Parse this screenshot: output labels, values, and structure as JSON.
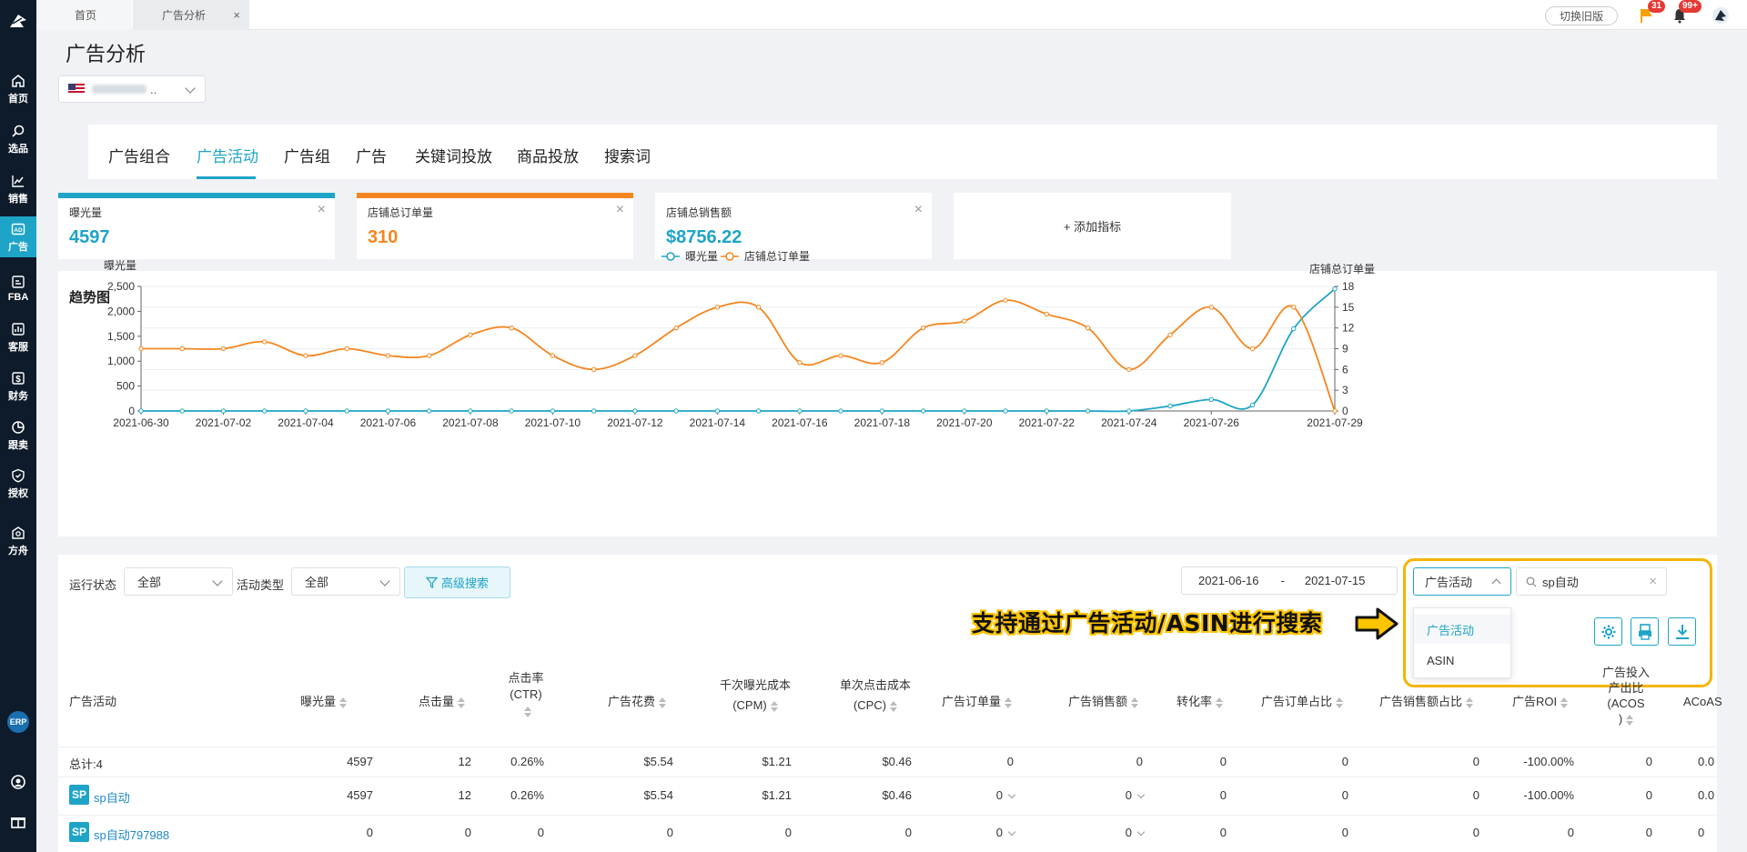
{
  "sidebar": {
    "items": [
      {
        "label": "首页",
        "icon": "home-icon"
      },
      {
        "label": "选品",
        "icon": "search-icon"
      },
      {
        "label": "销售",
        "icon": "chart-line-icon"
      },
      {
        "label": "广告",
        "icon": "ad-icon"
      },
      {
        "label": "FBA",
        "icon": "fba-icon"
      },
      {
        "label": "客服",
        "icon": "bar-chart-icon"
      },
      {
        "label": "财务",
        "icon": "dollar-icon"
      },
      {
        "label": "跟卖",
        "icon": "pie-chart-icon"
      },
      {
        "label": "授权",
        "icon": "shield-icon"
      },
      {
        "label": "方舟",
        "icon": "ark-icon"
      }
    ],
    "erp_label": "ERP"
  },
  "topbar": {
    "tabs": [
      {
        "label": "首页"
      },
      {
        "label": "广告分析"
      }
    ],
    "close_symbol": "×",
    "switch_label": "切换旧版",
    "flag_badge": "31",
    "bell_badge": "99+"
  },
  "page": {
    "title": "广告分析",
    "store_suffix": ".."
  },
  "nav": {
    "tabs": [
      "广告组合",
      "广告活动",
      "广告组",
      "广告",
      "关键词投放",
      "商品投放",
      "搜索词"
    ],
    "active_index": 1
  },
  "kpis": [
    {
      "label": "曝光量",
      "value": "4597",
      "color": "#1ea4c7"
    },
    {
      "label": "店铺总订单量",
      "value": "310",
      "color": "#f5861f"
    },
    {
      "label": "店铺总销售额",
      "value": "$8756.22",
      "color": "#1ea4c7"
    }
  ],
  "kpi_add_label": "+ 添加指标",
  "chart": {
    "title": "趋势图",
    "chart_data": {
      "type": "line",
      "x": [
        "2021-06-30",
        "2021-07-01",
        "2021-07-02",
        "2021-07-03",
        "2021-07-04",
        "2021-07-05",
        "2021-07-06",
        "2021-07-07",
        "2021-07-08",
        "2021-07-09",
        "2021-07-10",
        "2021-07-11",
        "2021-07-12",
        "2021-07-13",
        "2021-07-14",
        "2021-07-15",
        "2021-07-16",
        "2021-07-17",
        "2021-07-18",
        "2021-07-19",
        "2021-07-20",
        "2021-07-21",
        "2021-07-22",
        "2021-07-23",
        "2021-07-24",
        "2021-07-25",
        "2021-07-26",
        "2021-07-27",
        "2021-07-28",
        "2021-07-29"
      ],
      "x_tick_labels": [
        "2021-06-30",
        "2021-07-02",
        "2021-07-04",
        "2021-07-06",
        "2021-07-08",
        "2021-07-10",
        "2021-07-12",
        "2021-07-14",
        "2021-07-16",
        "2021-07-18",
        "2021-07-20",
        "2021-07-22",
        "2021-07-24",
        "2021-07-26",
        "2021-07-29"
      ],
      "series": [
        {
          "name": "曝光量",
          "axis": "left",
          "color": "#1ea4c7",
          "values": [
            0,
            0,
            0,
            0,
            0,
            0,
            0,
            0,
            0,
            0,
            0,
            0,
            0,
            0,
            0,
            0,
            0,
            0,
            0,
            0,
            0,
            0,
            0,
            0,
            0,
            100,
            230,
            120,
            1650,
            2450
          ]
        },
        {
          "name": "店铺总订单量",
          "axis": "right",
          "color": "#f5861f",
          "values": [
            9,
            9,
            9,
            10,
            8,
            9,
            8,
            8,
            11,
            12,
            8,
            6,
            8,
            12,
            15,
            15,
            7,
            8,
            7,
            12,
            13,
            16,
            14,
            12,
            6,
            11,
            15,
            9,
            15,
            0
          ]
        }
      ],
      "ylabel_left": "曝光量",
      "ylabel_right": "店铺总订单量",
      "yticks_left": [
        "0",
        "500",
        "1,000",
        "1,500",
        "2,000",
        "2,500"
      ],
      "yticks_right": [
        "0",
        "3",
        "6",
        "9",
        "12",
        "15",
        "18"
      ],
      "ylim_left": [
        0,
        2500
      ],
      "ylim_right": [
        0,
        18
      ],
      "legend_position": "top-center",
      "grid": true
    }
  },
  "filters": {
    "status_label": "运行状态",
    "status_value": "全部",
    "type_label": "活动类型",
    "type_value": "全部",
    "advanced_search": "高级搜索",
    "date_start": "2021-06-16",
    "date_sep": "-",
    "date_end": "2021-07-15",
    "search_type": "广告活动",
    "search_value": "sp自动",
    "dropdown_options": [
      "广告活动",
      "ASIN"
    ],
    "callout_text": "支持通过广告活动/ASIN进行搜索"
  },
  "table": {
    "headers": {
      "campaign": "广告活动",
      "impressions": "曝光量",
      "clicks": "点击量",
      "ctr_top": "点击率",
      "ctr_bottom": "(CTR)",
      "spend": "广告花费",
      "cpm_top": "千次曝光成本",
      "cpm_bottom": "(CPM)",
      "cpc_top": "单次点击成本",
      "cpc_bottom": "(CPC)",
      "orders": "广告订单量",
      "sales": "广告销售额",
      "cvr": "转化率",
      "order_share": "广告订单占比",
      "sales_share": "广告销售额占比",
      "roi": "广告ROI",
      "acos_1": "广告投入",
      "acos_2": "产出比",
      "acos_3": "(ACOS",
      "acos_4": ")",
      "acoas": "ACoAS"
    },
    "total": {
      "label": "总计:4",
      "impressions": "4597",
      "clicks": "12",
      "ctr": "0.26%",
      "spend": "$5.54",
      "cpm": "$1.21",
      "cpc": "$0.46",
      "orders": "0",
      "sales": "0",
      "cvr": "0",
      "order_share": "0",
      "sales_share": "0",
      "roi": "-100.00%",
      "acos": "0",
      "acoas": "0.0"
    },
    "rows": [
      {
        "badge": "SP",
        "name": "sp自动",
        "impressions": "4597",
        "clicks": "12",
        "ctr": "0.26%",
        "spend": "$5.54",
        "cpm": "$1.21",
        "cpc": "$0.46",
        "orders": "0",
        "sales": "0",
        "cvr": "0",
        "order_share": "0",
        "sales_share": "0",
        "roi": "-100.00%",
        "acos": "0",
        "acoas": "0.0"
      },
      {
        "badge": "SP",
        "name": "sp自动797988",
        "impressions": "0",
        "clicks": "0",
        "ctr": "0",
        "spend": "0",
        "cpm": "0",
        "cpc": "0",
        "orders": "0",
        "sales": "0",
        "cvr": "0",
        "order_share": "0",
        "sales_share": "0",
        "roi": "0",
        "acos": "0",
        "acoas": "0"
      }
    ]
  }
}
